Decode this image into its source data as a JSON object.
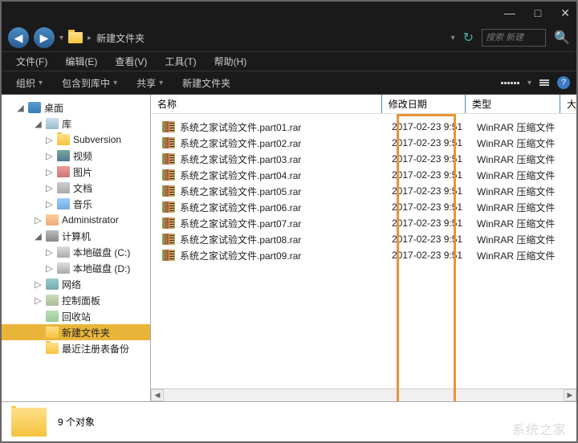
{
  "window": {
    "minimize": "—",
    "maximize": "□",
    "close": "✕"
  },
  "nav": {
    "breadcrumb": "新建文件夹",
    "chev_down": "▾",
    "chev_right": "▸",
    "search_placeholder": "搜索 新建"
  },
  "menu": {
    "file": "文件(F)",
    "edit": "编辑(E)",
    "view": "查看(V)",
    "tools": "工具(T)",
    "help": "帮助(H)"
  },
  "toolbar": {
    "organize": "组织",
    "include": "包含到库中",
    "share": "共享",
    "newfolder": "新建文件夹",
    "chev": "▾"
  },
  "columns": {
    "name": "名称",
    "date": "修改日期",
    "type": "类型",
    "size": "大"
  },
  "tree": {
    "desktop": "桌面",
    "lib": "库",
    "subversion": "Subversion",
    "video": "视频",
    "pictures": "图片",
    "documents": "文档",
    "music": "音乐",
    "admin": "Administrator",
    "computer": "计算机",
    "driveC": "本地磁盘 (C:)",
    "driveD": "本地磁盘 (D:)",
    "network": "网络",
    "control": "控制面板",
    "recycle": "回收站",
    "nfolder": "新建文件夹",
    "regback": "最近注册表备份"
  },
  "files": [
    {
      "name": "系统之家试验文件.part01.rar",
      "date": "2017-02-23 9:51",
      "type": "WinRAR 压缩文件"
    },
    {
      "name": "系统之家试验文件.part02.rar",
      "date": "2017-02-23 9:51",
      "type": "WinRAR 压缩文件"
    },
    {
      "name": "系统之家试验文件.part03.rar",
      "date": "2017-02-23 9:51",
      "type": "WinRAR 压缩文件"
    },
    {
      "name": "系统之家试验文件.part04.rar",
      "date": "2017-02-23 9:51",
      "type": "WinRAR 压缩文件"
    },
    {
      "name": "系统之家试验文件.part05.rar",
      "date": "2017-02-23 9:51",
      "type": "WinRAR 压缩文件"
    },
    {
      "name": "系统之家试验文件.part06.rar",
      "date": "2017-02-23 9:51",
      "type": "WinRAR 压缩文件"
    },
    {
      "name": "系统之家试验文件.part07.rar",
      "date": "2017-02-23 9:51",
      "type": "WinRAR 压缩文件"
    },
    {
      "name": "系统之家试验文件.part08.rar",
      "date": "2017-02-23 9:51",
      "type": "WinRAR 压缩文件"
    },
    {
      "name": "系统之家试验文件.part09.rar",
      "date": "2017-02-23 9:51",
      "type": "WinRAR 压缩文件"
    }
  ],
  "status": {
    "count": "9 个对象"
  },
  "watermark": "系统之家"
}
